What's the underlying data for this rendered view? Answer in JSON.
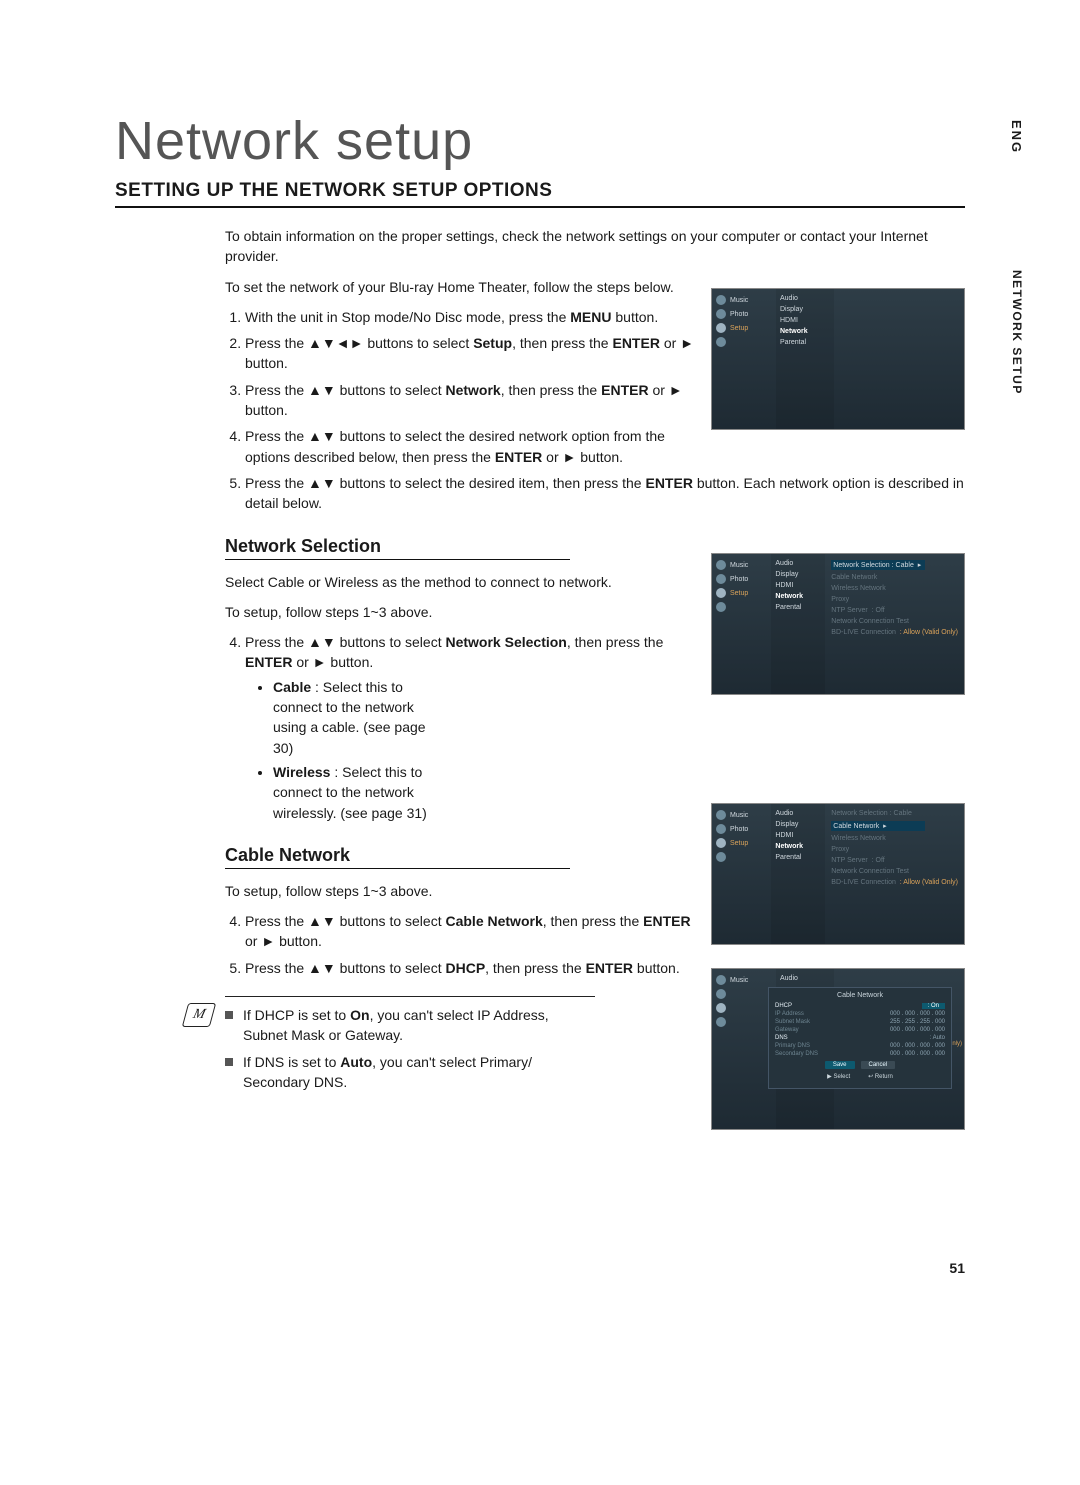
{
  "page": {
    "title": "Network setup",
    "section_heading": "SETTING UP THE NETWORK SETUP OPTIONS",
    "number": "51",
    "side_lang": "ENG",
    "side_section": "NETWORK SETUP"
  },
  "intro": {
    "p1": "To obtain information on the proper settings, check the network settings on your computer or contact your Internet provider.",
    "p2": "To set the network of your Blu-ray Home Theater, follow the steps below."
  },
  "steps_main": [
    {
      "n": "1.",
      "text_a": "With the unit in Stop mode/No Disc mode, press the ",
      "bold": "MENU",
      "text_b": " button."
    },
    {
      "n": "2.",
      "text_a": "Press the ▲▼◄► buttons to select ",
      "bold": "Setup",
      "text_b": ", then press the ",
      "bold2": "ENTER",
      "text_c": " or ► button."
    },
    {
      "n": "3.",
      "text_a": "Press the ▲▼ buttons to select ",
      "bold": "Network",
      "text_b": ", then press the ",
      "bold2": "ENTER",
      "text_c": " or ► button."
    },
    {
      "n": "4.",
      "text_a": "Press the ▲▼ buttons to select the desired network option from the options described below, then press the ",
      "bold": "ENTER",
      "text_b": " or ► button."
    },
    {
      "n": "5.",
      "text_a": "Press the ▲▼ buttons to select the desired item, then press the ",
      "bold": "ENTER",
      "text_b": " button. Each network option is described in detail below."
    }
  ],
  "network_selection": {
    "heading": "Network Selection",
    "p1": "Select Cable or Wireless as the method to connect to network.",
    "p2": "To setup, follow steps 1~3 above.",
    "step4_a": "Press the ▲▼ buttons to select ",
    "step4_bold": "Network Selection",
    "step4_b": ", then press the ",
    "step4_bold2": "ENTER",
    "step4_c": " or ► button.",
    "bullet_cable_bold": "Cable",
    "bullet_cable": " : Select this to connect to the network using a cable. (see page 30)",
    "bullet_wireless_bold": "Wireless",
    "bullet_wireless": " : Select this to connect to the network wirelessly. (see page 31)"
  },
  "cable_network": {
    "heading": "Cable Network",
    "p1": "To setup, follow steps 1~3 above.",
    "step4_a": "Press the ▲▼ buttons to select ",
    "step4_bold": "Cable Network",
    "step4_b": ", then press the ",
    "step4_bold2": "ENTER",
    "step4_c": " or ► button.",
    "step5_a": "Press the ▲▼ buttons to select ",
    "step5_bold": "DHCP",
    "step5_b": ", then press the ",
    "step5_bold2": "ENTER",
    "step5_c": " button."
  },
  "notes": {
    "n1_a": "If DHCP is set to ",
    "n1_bold": "On",
    "n1_b": ", you can't select IP Address, Subnet Mask or Gateway.",
    "n2_a": "If DNS is set to ",
    "n2_bold": "Auto",
    "n2_b": ", you can't select Primary/ Secondary DNS."
  },
  "ui": {
    "sidebar": {
      "music": "Music",
      "photo": "Photo",
      "setup": "Setup"
    },
    "menu": {
      "audio": "Audio",
      "display": "Display",
      "hdmi": "HDMI",
      "network": "Network",
      "parental": "Parental"
    },
    "net": {
      "sel_label": "Network Selection :",
      "sel_value": "Cable",
      "cable": "Cable Network",
      "wireless": "Wireless Network",
      "proxy": "Proxy",
      "ntp": "NTP Server",
      "ntp_v": ": Off",
      "test": "Network Connection Test",
      "bdlive": "BD-LIVE Connection",
      "bdlive_v": ": Allow (Valid Only)"
    },
    "dhcp": {
      "title": "Cable Network",
      "rows": [
        {
          "k": "DHCP",
          "v": ": On"
        },
        {
          "k": "IP Address",
          "v": "000 . 000 . 000 . 000"
        },
        {
          "k": "Subnet Mask",
          "v": "255 . 255 . 255 . 000"
        },
        {
          "k": "Gateway",
          "v": "000 . 000 . 000 . 000"
        },
        {
          "k": "DNS",
          "v": ": Auto"
        },
        {
          "k": "Primary DNS",
          "v": "000 . 000 . 000 . 000"
        },
        {
          "k": "Secondary DNS",
          "v": "000 . 000 . 000 . 000"
        }
      ],
      "save": "Save",
      "cancel": "Cancel",
      "select": "Select",
      "return": "Return",
      "side": "alid Only)"
    }
  }
}
